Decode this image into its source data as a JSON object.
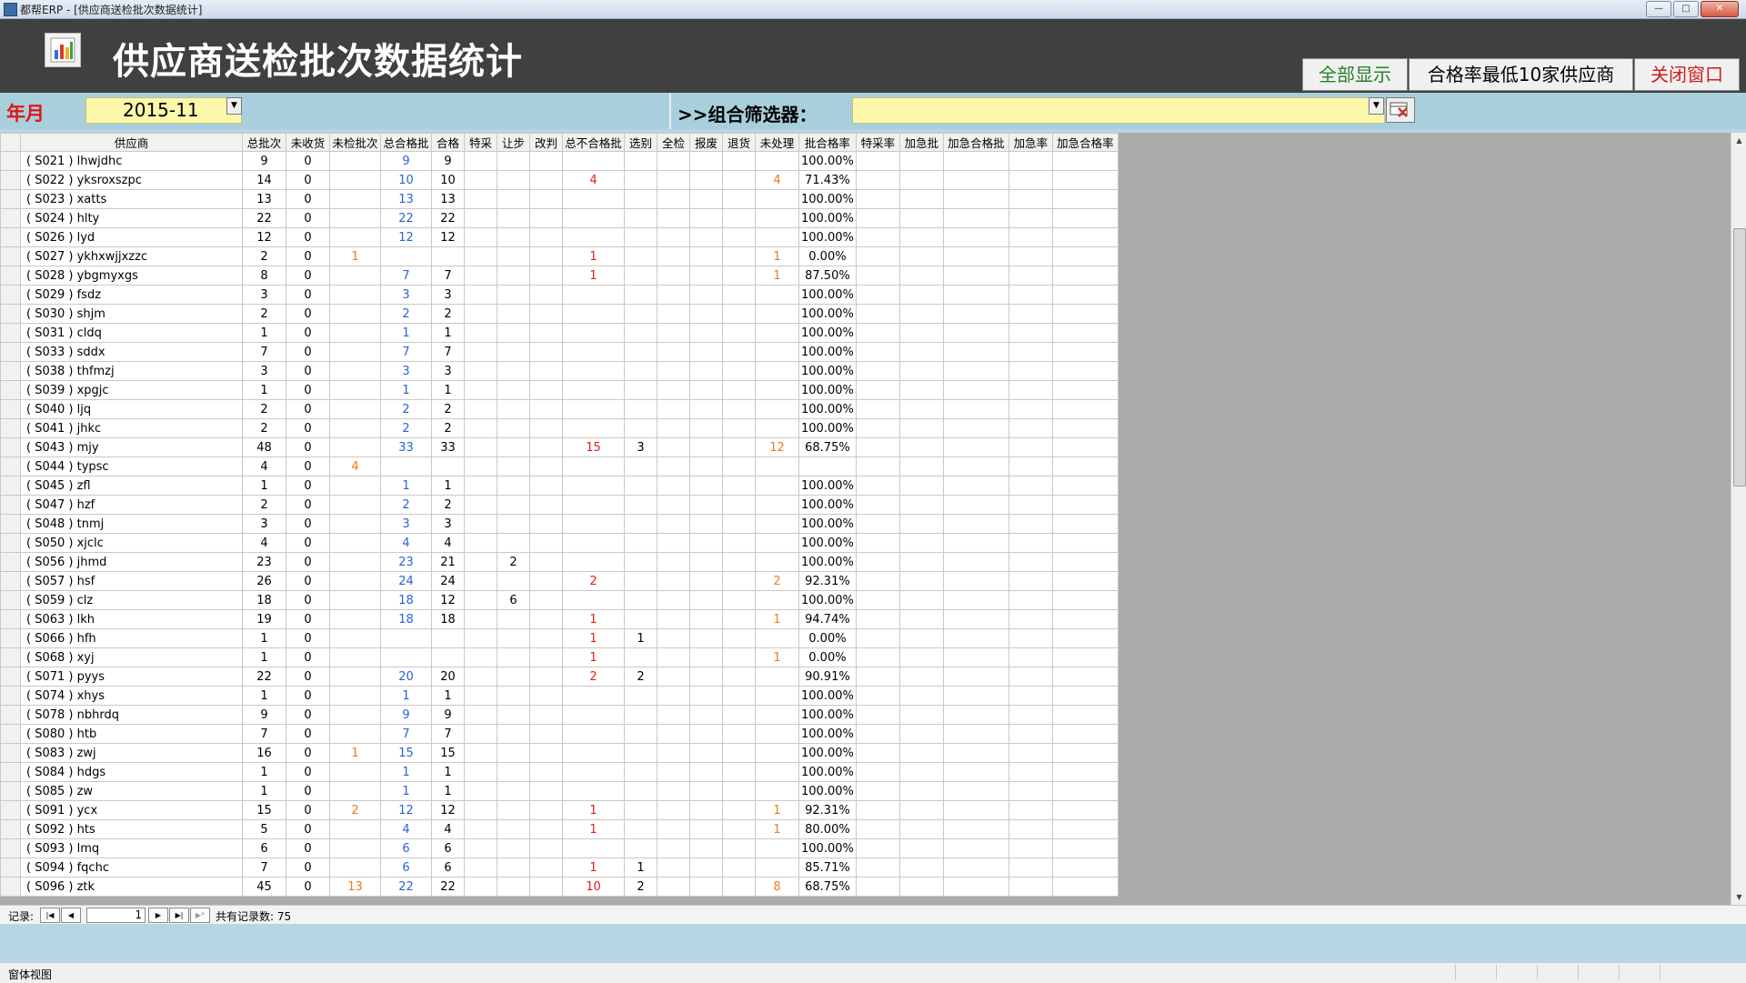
{
  "window": {
    "title": "都帮ERP - [供应商送检批次数据统计]",
    "min": "—",
    "max": "□",
    "close": "✕"
  },
  "header": {
    "title": "供应商送检批次数据统计",
    "buttons": {
      "show_all": "全部显示",
      "lowest10": "合格率最低10家供应商",
      "close": "关闭窗口"
    }
  },
  "filter": {
    "year_month_label": "年月",
    "year_month_value": "2015-11",
    "combo_label": ">>组合筛选器：",
    "combo_value": ""
  },
  "columns": [
    "供应商",
    "总批次",
    "未收货",
    "未检批次",
    "总合格批",
    "合格",
    "特采",
    "让步",
    "改判",
    "总不合格批",
    "选别",
    "全检",
    "报废",
    "退货",
    "未处理",
    "批合格率",
    "特采率",
    "加急批",
    "加急合格批",
    "加急率",
    "加急合格率"
  ],
  "rows": [
    [
      "( S021 ) lhwjdhc",
      "9",
      "0",
      "",
      "9",
      "9",
      "",
      "",
      "",
      "",
      "",
      "",
      "",
      "",
      "",
      "100.00%",
      "",
      "",
      "",
      "",
      ""
    ],
    [
      "( S022 ) yksroxszpc",
      "14",
      "0",
      "",
      "10",
      "10",
      "",
      "",
      "",
      "4",
      "",
      "",
      "",
      "",
      "4",
      "71.43%",
      "",
      "",
      "",
      "",
      ""
    ],
    [
      "( S023 ) xatts",
      "13",
      "0",
      "",
      "13",
      "13",
      "",
      "",
      "",
      "",
      "",
      "",
      "",
      "",
      "",
      "100.00%",
      "",
      "",
      "",
      "",
      ""
    ],
    [
      "( S024 ) hlty",
      "22",
      "0",
      "",
      "22",
      "22",
      "",
      "",
      "",
      "",
      "",
      "",
      "",
      "",
      "",
      "100.00%",
      "",
      "",
      "",
      "",
      ""
    ],
    [
      "( S026 ) lyd",
      "12",
      "0",
      "",
      "12",
      "12",
      "",
      "",
      "",
      "",
      "",
      "",
      "",
      "",
      "",
      "100.00%",
      "",
      "",
      "",
      "",
      ""
    ],
    [
      "( S027 ) ykhxwjjxzzc",
      "2",
      "0",
      "1",
      "",
      "",
      "",
      "",
      "",
      "1",
      "",
      "",
      "",
      "",
      "1",
      "0.00%",
      "",
      "",
      "",
      "",
      ""
    ],
    [
      "( S028 ) ybgmyxgs",
      "8",
      "0",
      "",
      "7",
      "7",
      "",
      "",
      "",
      "1",
      "",
      "",
      "",
      "",
      "1",
      "87.50%",
      "",
      "",
      "",
      "",
      ""
    ],
    [
      "( S029 ) fsdz",
      "3",
      "0",
      "",
      "3",
      "3",
      "",
      "",
      "",
      "",
      "",
      "",
      "",
      "",
      "",
      "100.00%",
      "",
      "",
      "",
      "",
      ""
    ],
    [
      "( S030 ) shjm",
      "2",
      "0",
      "",
      "2",
      "2",
      "",
      "",
      "",
      "",
      "",
      "",
      "",
      "",
      "",
      "100.00%",
      "",
      "",
      "",
      "",
      ""
    ],
    [
      "( S031 ) cldq",
      "1",
      "0",
      "",
      "1",
      "1",
      "",
      "",
      "",
      "",
      "",
      "",
      "",
      "",
      "",
      "100.00%",
      "",
      "",
      "",
      "",
      ""
    ],
    [
      "( S033 ) sddx",
      "7",
      "0",
      "",
      "7",
      "7",
      "",
      "",
      "",
      "",
      "",
      "",
      "",
      "",
      "",
      "100.00%",
      "",
      "",
      "",
      "",
      ""
    ],
    [
      "( S038 ) thfmzj",
      "3",
      "0",
      "",
      "3",
      "3",
      "",
      "",
      "",
      "",
      "",
      "",
      "",
      "",
      "",
      "100.00%",
      "",
      "",
      "",
      "",
      ""
    ],
    [
      "( S039 ) xpgjc",
      "1",
      "0",
      "",
      "1",
      "1",
      "",
      "",
      "",
      "",
      "",
      "",
      "",
      "",
      "",
      "100.00%",
      "",
      "",
      "",
      "",
      ""
    ],
    [
      "( S040 ) ljq",
      "2",
      "0",
      "",
      "2",
      "2",
      "",
      "",
      "",
      "",
      "",
      "",
      "",
      "",
      "",
      "100.00%",
      "",
      "",
      "",
      "",
      ""
    ],
    [
      "( S041 ) jhkc",
      "2",
      "0",
      "",
      "2",
      "2",
      "",
      "",
      "",
      "",
      "",
      "",
      "",
      "",
      "",
      "100.00%",
      "",
      "",
      "",
      "",
      ""
    ],
    [
      "( S043 ) mjy",
      "48",
      "0",
      "",
      "33",
      "33",
      "",
      "",
      "",
      "15",
      "3",
      "",
      "",
      "",
      "12",
      "68.75%",
      "",
      "",
      "",
      "",
      ""
    ],
    [
      "( S044 ) typsc",
      "4",
      "0",
      "4",
      "",
      "",
      "",
      "",
      "",
      "",
      "",
      "",
      "",
      "",
      "",
      "",
      "",
      "",
      "",
      "",
      ""
    ],
    [
      "( S045 ) zfl",
      "1",
      "0",
      "",
      "1",
      "1",
      "",
      "",
      "",
      "",
      "",
      "",
      "",
      "",
      "",
      "100.00%",
      "",
      "",
      "",
      "",
      ""
    ],
    [
      "( S047 ) hzf",
      "2",
      "0",
      "",
      "2",
      "2",
      "",
      "",
      "",
      "",
      "",
      "",
      "",
      "",
      "",
      "100.00%",
      "",
      "",
      "",
      "",
      ""
    ],
    [
      "( S048 ) tnmj",
      "3",
      "0",
      "",
      "3",
      "3",
      "",
      "",
      "",
      "",
      "",
      "",
      "",
      "",
      "",
      "100.00%",
      "",
      "",
      "",
      "",
      ""
    ],
    [
      "( S050 ) xjclc",
      "4",
      "0",
      "",
      "4",
      "4",
      "",
      "",
      "",
      "",
      "",
      "",
      "",
      "",
      "",
      "100.00%",
      "",
      "",
      "",
      "",
      ""
    ],
    [
      "( S056 ) jhmd",
      "23",
      "0",
      "",
      "23",
      "21",
      "",
      "2",
      "",
      "",
      "",
      "",
      "",
      "",
      "",
      "100.00%",
      "",
      "",
      "",
      "",
      ""
    ],
    [
      "( S057 ) hsf",
      "26",
      "0",
      "",
      "24",
      "24",
      "",
      "",
      "",
      "2",
      "",
      "",
      "",
      "",
      "2",
      "92.31%",
      "",
      "",
      "",
      "",
      ""
    ],
    [
      "( S059 ) clz",
      "18",
      "0",
      "",
      "18",
      "12",
      "",
      "6",
      "",
      "",
      "",
      "",
      "",
      "",
      "",
      "100.00%",
      "",
      "",
      "",
      "",
      ""
    ],
    [
      "( S063 ) lkh",
      "19",
      "0",
      "",
      "18",
      "18",
      "",
      "",
      "",
      "1",
      "",
      "",
      "",
      "",
      "1",
      "94.74%",
      "",
      "",
      "",
      "",
      ""
    ],
    [
      "( S066 ) hfh",
      "1",
      "0",
      "",
      "",
      "",
      "",
      "",
      "",
      "1",
      "1",
      "",
      "",
      "",
      "",
      "0.00%",
      "",
      "",
      "",
      "",
      ""
    ],
    [
      "( S068 ) xyj",
      "1",
      "0",
      "",
      "",
      "",
      "",
      "",
      "",
      "1",
      "",
      "",
      "",
      "",
      "1",
      "0.00%",
      "",
      "",
      "",
      "",
      ""
    ],
    [
      "( S071 ) pyys",
      "22",
      "0",
      "",
      "20",
      "20",
      "",
      "",
      "",
      "2",
      "2",
      "",
      "",
      "",
      "",
      "90.91%",
      "",
      "",
      "",
      "",
      ""
    ],
    [
      "( S074 ) xhys",
      "1",
      "0",
      "",
      "1",
      "1",
      "",
      "",
      "",
      "",
      "",
      "",
      "",
      "",
      "",
      "100.00%",
      "",
      "",
      "",
      "",
      ""
    ],
    [
      "( S078 ) nbhrdq",
      "9",
      "0",
      "",
      "9",
      "9",
      "",
      "",
      "",
      "",
      "",
      "",
      "",
      "",
      "",
      "100.00%",
      "",
      "",
      "",
      "",
      ""
    ],
    [
      "( S080 ) htb",
      "7",
      "0",
      "",
      "7",
      "7",
      "",
      "",
      "",
      "",
      "",
      "",
      "",
      "",
      "",
      "100.00%",
      "",
      "",
      "",
      "",
      ""
    ],
    [
      "( S083 ) zwj",
      "16",
      "0",
      "1",
      "15",
      "15",
      "",
      "",
      "",
      "",
      "",
      "",
      "",
      "",
      "",
      "100.00%",
      "",
      "",
      "",
      "",
      ""
    ],
    [
      "( S084 ) hdgs",
      "1",
      "0",
      "",
      "1",
      "1",
      "",
      "",
      "",
      "",
      "",
      "",
      "",
      "",
      "",
      "100.00%",
      "",
      "",
      "",
      "",
      ""
    ],
    [
      "( S085 ) zw",
      "1",
      "0",
      "",
      "1",
      "1",
      "",
      "",
      "",
      "",
      "",
      "",
      "",
      "",
      "",
      "100.00%",
      "",
      "",
      "",
      "",
      ""
    ],
    [
      "( S091 ) ycx",
      "15",
      "0",
      "2",
      "12",
      "12",
      "",
      "",
      "",
      "1",
      "",
      "",
      "",
      "",
      "1",
      "92.31%",
      "",
      "",
      "",
      "",
      ""
    ],
    [
      "( S092 ) hts",
      "5",
      "0",
      "",
      "4",
      "4",
      "",
      "",
      "",
      "1",
      "",
      "",
      "",
      "",
      "1",
      "80.00%",
      "",
      "",
      "",
      "",
      ""
    ],
    [
      "( S093 ) lmq",
      "6",
      "0",
      "",
      "6",
      "6",
      "",
      "",
      "",
      "",
      "",
      "",
      "",
      "",
      "",
      "100.00%",
      "",
      "",
      "",
      "",
      ""
    ],
    [
      "( S094 ) fqchc",
      "7",
      "0",
      "",
      "6",
      "6",
      "",
      "",
      "",
      "1",
      "1",
      "",
      "",
      "",
      "",
      "85.71%",
      "",
      "",
      "",
      "",
      ""
    ],
    [
      "( S096 ) ztk",
      "45",
      "0",
      "13",
      "22",
      "22",
      "",
      "",
      "",
      "10",
      "2",
      "",
      "",
      "",
      "8",
      "68.75%",
      "",
      "",
      "",
      "",
      ""
    ]
  ],
  "navigation": {
    "record_label": "记录:",
    "first": "|◀",
    "prev": "◀",
    "current": "1",
    "next": "▶",
    "last": "▶|",
    "new": "▶*",
    "total_label": "共有记录数: 75"
  },
  "status_bar": {
    "text": "窗体视图"
  },
  "colors": {
    "header_bg": "#404040",
    "filter_bg": "#a9cfdc",
    "input_bg": "#fdf7a9",
    "blue_value": "#2a62d4",
    "red_value": "#e81d1d",
    "orange_value": "#ee7a1b"
  },
  "icons": {
    "app": "app-icon",
    "logo": "bar-chart-icon",
    "clear": "clear-filter-icon"
  }
}
